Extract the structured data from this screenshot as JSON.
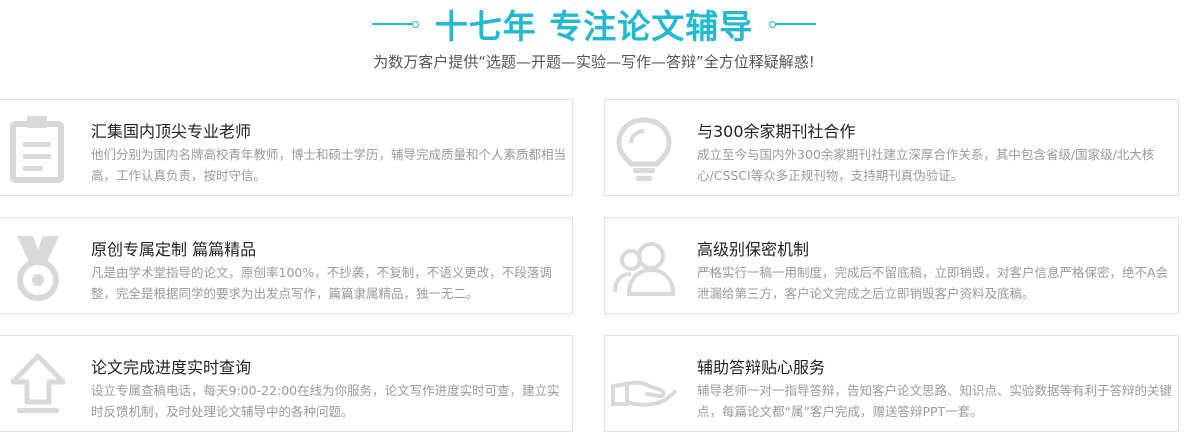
{
  "header": {
    "title": "十七年 专注论文辅导",
    "subtitle": "为数万客户提供“选题—开题—实验—写作—答辩”全方位释疑解惑!"
  },
  "colors": {
    "accent": "#22b9d1",
    "icon": "#d9d9d9",
    "border": "#e3e3e3"
  },
  "features": [
    {
      "icon": "clipboard-icon",
      "title": "汇集国内顶尖专业老师",
      "desc": "他们分别为国内名牌高校青年教师，博士和硕士学历，辅导完成质量和个人素质都相当高，工作认真负责，按时守信。"
    },
    {
      "icon": "lightbulb-icon",
      "title": "与300余家期刊社合作",
      "desc": "成立至今与国内外300余家期刊社建立深厚合作关系，其中包含省级/国家级/北大核心/CSSCI等众多正规刊物，支持期刊真伪验证。"
    },
    {
      "icon": "medal-icon",
      "title": "原创专属定制 篇篇精品",
      "desc": "凡是由学术堂指导的论文，原创率100%，不抄袭，不复制，不语义更改，不段落调整，完全是根据同学的要求为出发点写作，篇篇隶属精品，独一无二。"
    },
    {
      "icon": "users-icon",
      "title": "高级别保密机制",
      "desc": "严格实行一稿一用制度，完成后不留底稿，立即销毁，对客户信息严格保密，绝不A会泄漏给第三方，客户论文完成之后立即销毁客户资料及底稿。"
    },
    {
      "icon": "upload-arrow-icon",
      "title": "论文完成进度实时查询",
      "desc": "设立专属查稿电话，每天9:00-22:00在线为你服务，论文写作进度实时可查，建立实时反馈机制，及时处理论文辅导中的各种问题。"
    },
    {
      "icon": "helping-hand-icon",
      "title": "辅助答辩贴心服务",
      "desc": "辅导老师一对一指导答辩，告知客户论文思路、知识点、实验数据等有利于答辩的关键点，每篇论文都“属”客户完成，赠送答辩PPT一套。"
    }
  ]
}
